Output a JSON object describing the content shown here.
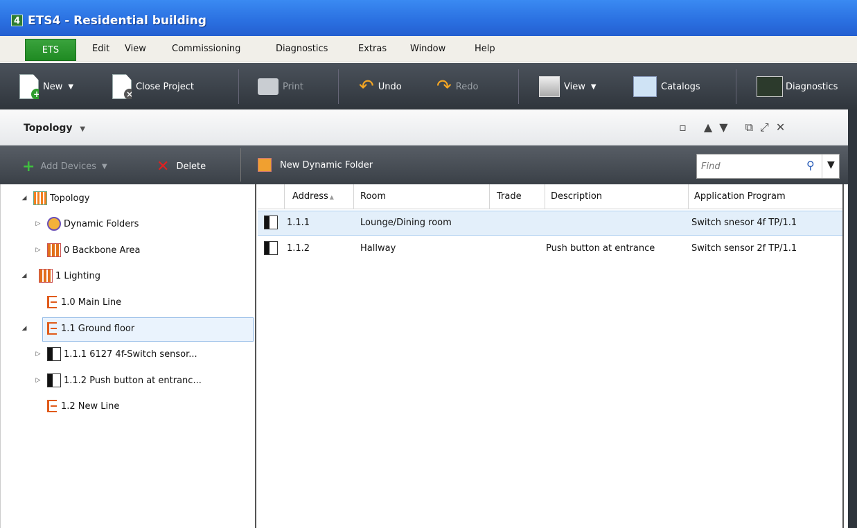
{
  "window": {
    "title": "ETS4 - Residential building",
    "icon_glyph": "4"
  },
  "menubar": {
    "items": [
      "ETS",
      "Edit",
      "View",
      "Commissioning",
      "Diagnostics",
      "Extras",
      "Window",
      "Help"
    ]
  },
  "toolbar": {
    "new_label": "New",
    "close_project_label": "Close Project",
    "print_label": "Print",
    "undo_label": "Undo",
    "redo_label": "Redo",
    "view_label": "View",
    "catalogs_label": "Catalogs",
    "diagnostics_label": "Diagnostics"
  },
  "panel": {
    "title": "Topology",
    "title_arrow": "▼",
    "controls": "▫ ▲▼ ⧉⤢✕"
  },
  "subtoolbar": {
    "add_devices_label": "Add Devices",
    "delete_label": "Delete",
    "new_dynamic_folder_label": "New Dynamic Folder",
    "find_placeholder": "Find"
  },
  "tree": {
    "items": [
      {
        "label": "Topology",
        "twisty": "◢"
      },
      {
        "label": "Dynamic Folders",
        "twisty": "▷"
      },
      {
        "label": "0 Backbone Area",
        "twisty": "▷"
      },
      {
        "label": "1 Lighting",
        "twisty": "◢"
      },
      {
        "label": "1.0 Main Line",
        "twisty": ""
      },
      {
        "label": "1.1 Ground floor",
        "twisty": "◢"
      },
      {
        "label": "1.1.1  6127 4f-Switch sensor...",
        "twisty": "▷"
      },
      {
        "label": "1.1.2 Push button at entranc...",
        "twisty": "▷"
      },
      {
        "label": "1.2 New Line",
        "twisty": ""
      }
    ]
  },
  "grid": {
    "columns": [
      "Address",
      "Room",
      "Trade",
      "Description",
      "Application Program"
    ],
    "sort_indicator": "▲",
    "rows": [
      {
        "address": "1.1.1",
        "room": "Lounge/Dining room",
        "trade": "",
        "description": "",
        "application": "Switch snesor 4f TP/1.1"
      },
      {
        "address": "1.1.2",
        "room": "Hallway",
        "trade": "",
        "description": "Push button at entrance",
        "application": "Switch sensor 2f TP/1.1"
      }
    ]
  },
  "colors": {
    "titlebar": "#2a6fe0",
    "menu_ets": "#1f8a22",
    "toolbar": "#3a4047",
    "selection": "#e3effa"
  }
}
